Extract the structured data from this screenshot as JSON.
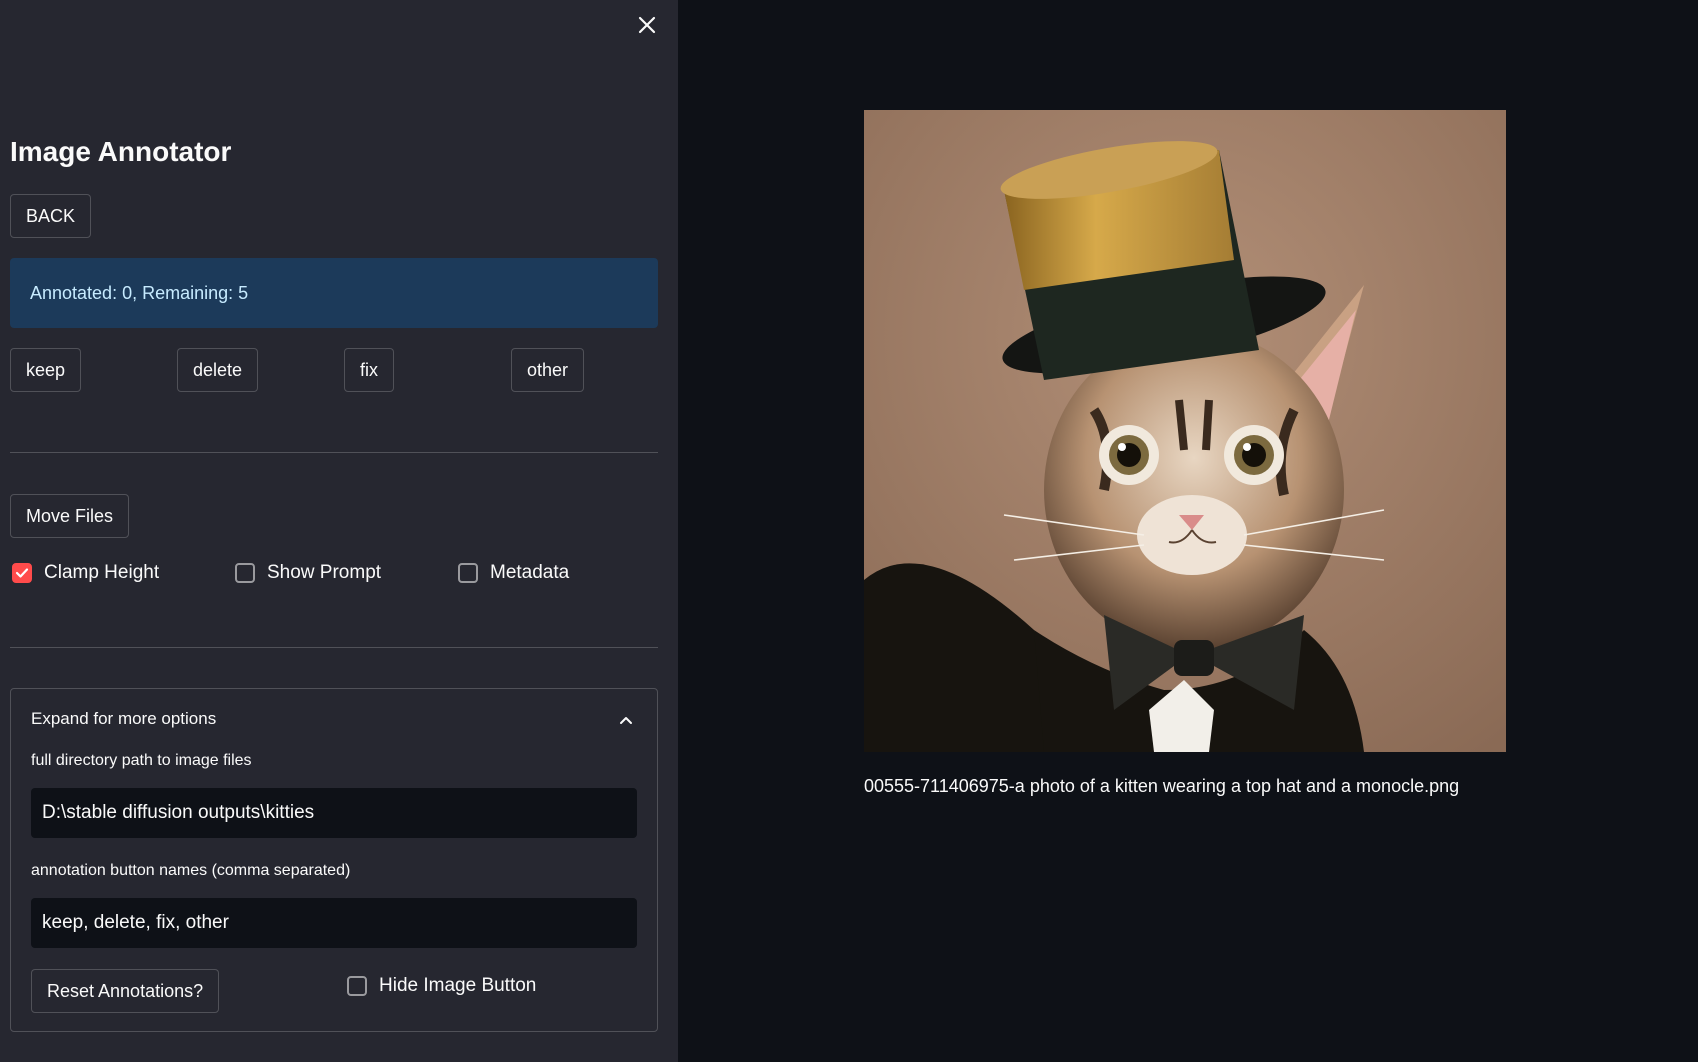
{
  "sidebar": {
    "title": "Image Annotator",
    "back_label": "BACK",
    "status_text": "Annotated: 0, Remaining: 5",
    "annotation_buttons": [
      "keep",
      "delete",
      "fix",
      "other"
    ],
    "move_files_label": "Move Files",
    "checkboxes": [
      {
        "label": "Clamp Height",
        "checked": true
      },
      {
        "label": "Show Prompt",
        "checked": false
      },
      {
        "label": "Metadata",
        "checked": false
      }
    ],
    "expander": {
      "header": "Expand for more options",
      "dir_label": "full directory path to image files",
      "dir_value": "D:\\stable diffusion outputs\\kitties",
      "names_label": "annotation button names (comma separated)",
      "names_value": "keep, delete, fix, other",
      "reset_label": "Reset Annotations?",
      "hide_image_label": "Hide Image Button",
      "hide_image_checked": false
    }
  },
  "main": {
    "caption": "00555-711406975-a photo of a kitten wearing a top hat and a monocle.png"
  },
  "colors": {
    "sidebar_bg": "#262730",
    "main_bg": "#0e1117",
    "info_bg": "#1c3a5a",
    "info_text": "#c7ebff",
    "accent": "#ff4b4b"
  }
}
